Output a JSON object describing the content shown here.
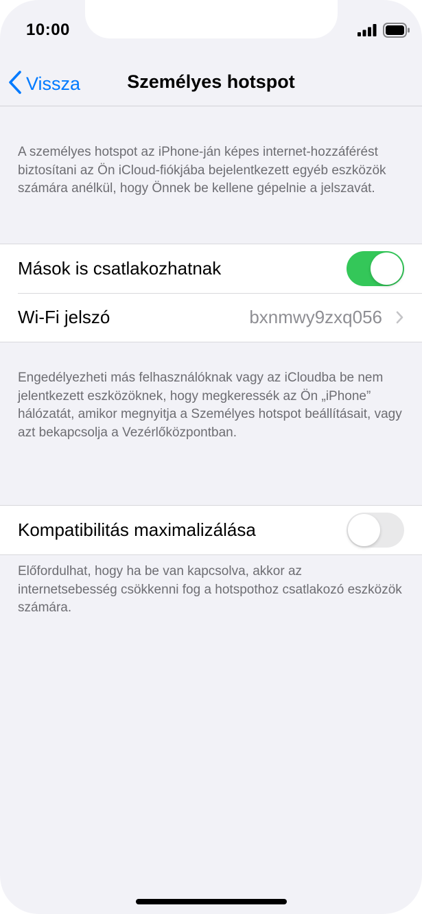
{
  "status_bar": {
    "time": "10:00",
    "signal_icon": "cellular-signal-icon",
    "battery_icon": "battery-full-icon"
  },
  "nav": {
    "back_label": "Vissza",
    "back_icon": "chevron-left-icon",
    "title": "Személyes hotspot"
  },
  "intro_text": "A személyes hotspot az iPhone-ján képes internet-hozzáférést biztosítani az Ön iCloud-fiókjába bejelentkezett egyéb eszközök számára anélkül, hogy Önnek be kellene gépelnie a jelszavát.",
  "group1": {
    "allow_others": {
      "label": "Mások is csatlakozhatnak",
      "enabled": true
    },
    "wifi_password": {
      "label": "Wi-Fi jelszó",
      "value": "bxnmwy9zxq056"
    }
  },
  "group1_footer": "Engedélyezheti más felhasználóknak vagy az iCloudba be nem jelentkezett eszközöknek, hogy megkeressék az Ön „iPhone” hálózatát, amikor megnyitja a Személyes hotspot beállításait, vagy azt bekapcsolja a Vezérlőközpontban.",
  "group2": {
    "maximize_compatibility": {
      "label": "Kompatibilitás maximalizálása",
      "enabled": false
    }
  },
  "group2_footer": "Előfordulhat, hogy ha be van kapcsolva, akkor az internetsebesség csökkenni fog a hotspothoz csatlakozó eszközök számára.",
  "colors": {
    "accent": "#007aff",
    "toggle_on": "#34c759",
    "background": "#f2f2f7",
    "secondary_text": "#6d6d72"
  }
}
